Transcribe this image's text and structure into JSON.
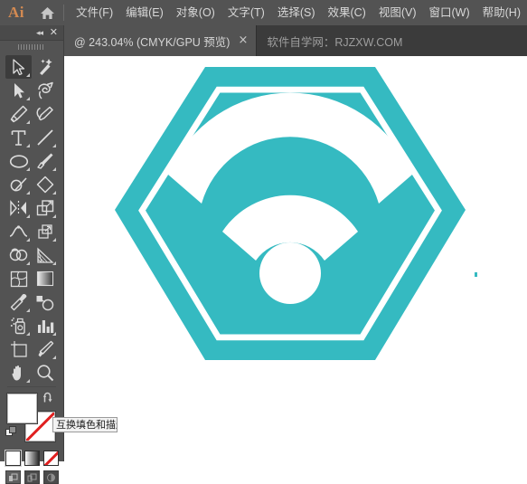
{
  "app": {
    "name": "Ai",
    "logo_color": "#d38a52",
    "home_icon": "home-icon"
  },
  "menubar": {
    "items": [
      {
        "label": "文件(F)",
        "name": "menu-file"
      },
      {
        "label": "编辑(E)",
        "name": "menu-edit"
      },
      {
        "label": "对象(O)",
        "name": "menu-object"
      },
      {
        "label": "文字(T)",
        "name": "menu-type"
      },
      {
        "label": "选择(S)",
        "name": "menu-select"
      },
      {
        "label": "效果(C)",
        "name": "menu-effect"
      },
      {
        "label": "视图(V)",
        "name": "menu-view"
      },
      {
        "label": "窗口(W)",
        "name": "menu-window"
      },
      {
        "label": "帮助(H)",
        "name": "menu-help"
      }
    ]
  },
  "tabs": [
    {
      "label": "@ 243.04% (CMYK/GPU 预览)",
      "zoom": "243.04%",
      "color_mode": "CMYK",
      "preview_mode": "GPU 预览",
      "close_glyph": "×",
      "active": true
    },
    {
      "label": "软件自学网：RJZXW.COM",
      "active": false
    }
  ],
  "toolpanel": {
    "collapse_glyph": "◂◂",
    "close_glyph": "✕",
    "tools": [
      {
        "name": "tool-selection",
        "title": "选择工具",
        "selected": true,
        "has_flyout": true
      },
      {
        "name": "tool-magic-wand",
        "title": "魔棒工具",
        "selected": false,
        "has_flyout": false
      },
      {
        "name": "tool-direct-selection",
        "title": "直接选择工具",
        "selected": false,
        "has_flyout": true
      },
      {
        "name": "tool-lasso",
        "title": "套索工具",
        "selected": false,
        "has_flyout": false
      },
      {
        "name": "tool-pen",
        "title": "钢笔工具",
        "selected": false,
        "has_flyout": true
      },
      {
        "name": "tool-curvature",
        "title": "曲率工具",
        "selected": false,
        "has_flyout": false
      },
      {
        "name": "tool-type",
        "title": "文字工具",
        "selected": false,
        "has_flyout": true
      },
      {
        "name": "tool-line-segment",
        "title": "直线段工具",
        "selected": false,
        "has_flyout": true
      },
      {
        "name": "tool-ellipse",
        "title": "椭圆工具",
        "selected": false,
        "has_flyout": true
      },
      {
        "name": "tool-paintbrush",
        "title": "画笔工具",
        "selected": false,
        "has_flyout": true
      },
      {
        "name": "tool-shaper",
        "title": "Shaper 工具",
        "selected": false,
        "has_flyout": true
      },
      {
        "name": "tool-eraser",
        "title": "橡皮擦工具",
        "selected": false,
        "has_flyout": true
      },
      {
        "name": "tool-rotate",
        "title": "旋转工具",
        "selected": false,
        "has_flyout": true
      },
      {
        "name": "tool-scale",
        "title": "比例缩放工具",
        "selected": false,
        "has_flyout": true
      },
      {
        "name": "tool-width",
        "title": "宽度工具",
        "selected": false,
        "has_flyout": true
      },
      {
        "name": "tool-free-transform",
        "title": "自由变换工具",
        "selected": false,
        "has_flyout": true
      },
      {
        "name": "tool-shape-builder",
        "title": "形状生成器工具",
        "selected": false,
        "has_flyout": true
      },
      {
        "name": "tool-perspective-grid",
        "title": "透视网格工具",
        "selected": false,
        "has_flyout": true
      },
      {
        "name": "tool-mesh",
        "title": "网格工具",
        "selected": false,
        "has_flyout": false
      },
      {
        "name": "tool-gradient",
        "title": "渐变工具",
        "selected": false,
        "has_flyout": false
      },
      {
        "name": "tool-eyedropper",
        "title": "吸管工具",
        "selected": false,
        "has_flyout": true
      },
      {
        "name": "tool-blend",
        "title": "混合工具",
        "selected": false,
        "has_flyout": false
      },
      {
        "name": "tool-symbol-sprayer",
        "title": "符号喷枪工具",
        "selected": false,
        "has_flyout": true
      },
      {
        "name": "tool-column-graph",
        "title": "柱形图工具",
        "selected": false,
        "has_flyout": true
      },
      {
        "name": "tool-artboard",
        "title": "画板工具",
        "selected": false,
        "has_flyout": false
      },
      {
        "name": "tool-slice",
        "title": "切片工具",
        "selected": false,
        "has_flyout": true
      },
      {
        "name": "tool-hand",
        "title": "抓手工具",
        "selected": false,
        "has_flyout": true
      },
      {
        "name": "tool-zoom",
        "title": "缩放工具",
        "selected": false,
        "has_flyout": false
      }
    ],
    "fill_stroke": {
      "fill_color": "#ffffff",
      "stroke_color": "none",
      "swap_icon": "swap-arrow-icon",
      "default_icon": "default-colors-icon"
    },
    "tooltip": {
      "text": "互换填色和描边",
      "visible": true
    },
    "fill_types": [
      {
        "name": "fill-type-color",
        "label": "颜色",
        "selected": true
      },
      {
        "name": "fill-type-gradient",
        "label": "渐变",
        "selected": false
      },
      {
        "name": "fill-type-none",
        "label": "无",
        "selected": false
      }
    ],
    "screen_modes": [
      {
        "name": "screen-mode-normal",
        "label": "正常屏幕模式",
        "selected": true
      },
      {
        "name": "screen-mode-full-menu",
        "label": "带有菜单栏的全屏模式",
        "selected": false
      },
      {
        "name": "screen-mode-full",
        "label": "全屏模式",
        "selected": false
      }
    ]
  },
  "artwork": {
    "title": "WiFi 六边形图标",
    "hex_fill": "#35bac1",
    "inner_outline_color": "#ffffff",
    "wifi_color": "#ffffff",
    "background": "#ffffff"
  }
}
